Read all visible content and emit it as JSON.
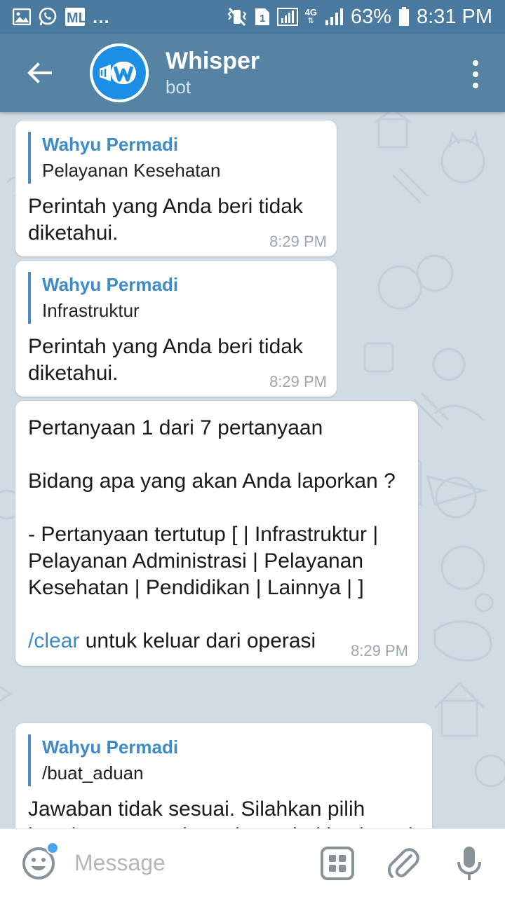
{
  "status_bar": {
    "battery_percent": "63%",
    "time": "8:31 PM",
    "overflow": "...",
    "sim_slot": "1",
    "network": "4G",
    "icons": [
      "gallery-icon",
      "whatsapp-icon",
      "ml-icon",
      "vibrate-icon",
      "sim-icon",
      "signal-icon",
      "battery-icon"
    ]
  },
  "header": {
    "title": "Whisper",
    "subtitle": "bot",
    "back_icon": "arrow-left-icon",
    "menu_icon": "more-vertical-icon",
    "avatar_icon": "whisper-logo-icon"
  },
  "messages": [
    {
      "reply_name": "Wahyu Permadi",
      "reply_text": "Pelayanan Kesehatan",
      "text": "Perintah yang Anda beri tidak diketahui.",
      "time": "8:29 PM"
    },
    {
      "reply_name": "Wahyu Permadi",
      "reply_text": "Infrastruktur",
      "text": "Perintah yang Anda beri tidak diketahui.",
      "time": "8:29 PM"
    },
    {
      "text": "Pertanyaan 1 dari 7 pertanyaan\n\nBidang apa yang akan Anda laporkan ?\n\n- Pertanyaan tertutup [ | Infrastruktur | Pelayanan Administrasi | Pelayanan Kesehatan | Pendidikan | Lainnya | ]\n\n",
      "command": "/clear",
      "command_suffix": " untuk keluar dari operasi",
      "time": "8:29 PM"
    },
    {
      "reply_name": "Wahyu Permadi",
      "reply_text": "/buat_aduan",
      "text": "Jawaban tidak sesuai. Silahkan pilih jawaban yang ada pada tombol keyboard."
    }
  ],
  "input_bar": {
    "placeholder": "Message",
    "emoji_icon": "emoji-icon",
    "keyboard_icon": "bot-keyboard-icon",
    "attach_icon": "paperclip-icon",
    "mic_icon": "microphone-icon"
  },
  "colors": {
    "header": "#5682a3",
    "status_bar": "#4a7aa0",
    "link": "#3f8bc9",
    "chat_bg": "#d0dbe4"
  }
}
